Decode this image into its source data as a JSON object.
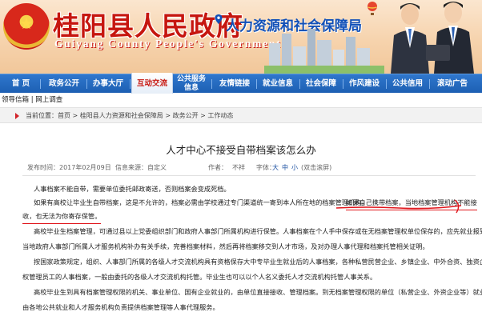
{
  "header": {
    "site_title": "桂阳县人民政府",
    "site_title_en": "Guiyang County People's Government",
    "dept_title": "人力资源和社会保障局"
  },
  "nav": {
    "items": [
      {
        "label": "首  页"
      },
      {
        "label": "政务公开"
      },
      {
        "label": "办事大厅"
      },
      {
        "label": "互动交流",
        "active": true
      },
      {
        "label": "公共服务信息"
      },
      {
        "label": "友情链接"
      },
      {
        "label": "就业信息"
      },
      {
        "label": "社会保障"
      },
      {
        "label": "作风建设"
      },
      {
        "label": "公共信用"
      },
      {
        "label": "滚动广告"
      }
    ]
  },
  "subbar": {
    "link1": "领导信箱",
    "separator": "|",
    "link2": "网上调查"
  },
  "breadcrumb": {
    "lead": "当前位置：",
    "items": [
      "首页",
      "桂阳县人力资源和社会保障局",
      "政务公开",
      "工作动态"
    ],
    "separator": " > "
  },
  "article": {
    "title": "人才中心不接受自带档案该怎么办",
    "meta": {
      "date_label": "发布时间：",
      "date": "2017年02月09日",
      "source_label": "信息来源：",
      "source": "自定义",
      "author_label": "作者：",
      "author": "不祥",
      "fontsize_label": "字体：",
      "fs_large": "大",
      "fs_medium": "中",
      "fs_small": "小",
      "print": "(双击滚屏)"
    },
    "p1": "人事档案不能自带，需要单位委托邮政寄送，否则档案会变成死档。",
    "p2_l1_a": "如果有高校让毕业生自带档案，这是不允许的，档案必需由学校通过专门渠道统一寄到本人所在地的档案管理机构。",
    "p2_l1_b": "如果自己携带档案，当地档案管理机构不能接",
    "p2_l2_a": "收，也无法为你寄存保管。",
    "p3": "高校毕业生档案管理，可通过县以上党委组织部门和政府人事部门所属机构进行保管。人事档案在个人手中保存或在无档案管理权单位保存的，应先就业报到证先到",
    "p4_l1": "当地政府人事部门所属人才服务机构补办有关手续，完善档案材料，然后再将档案移交到人才市场，及对办理人事代理和档案托管相关证明。",
    "p4_l2": "按国家政策规定，组织、人事部门所属的各级人才交流机构具有资格保存大中专毕业生就业后的人事档案，各种私营民营企业、乡镇企业、中外合资、独资企业都无",
    "p5_l1": "权管理员工的人事档案，一般由委托的各级人才交流机构托管。毕业生也可以以个人名义委托人才交流机构托管人事关系。",
    "p5_l2": "高校毕业生到具有档案管理权限的机关、事业单位、国有企业就业的，由单位直接接收、管理档案。到无档案管理权限的单位（私营企业、外资企业等）就业的，可",
    "p5_l3": "由各地公共就业和人才服务机构负责提供档案管理等人事代理服务。"
  },
  "colors": {
    "brand_red": "#c6160f",
    "nav_blue": "#1d5fb3",
    "dept_blue": "#1150b8",
    "annotation_red": "#e0151b"
  }
}
